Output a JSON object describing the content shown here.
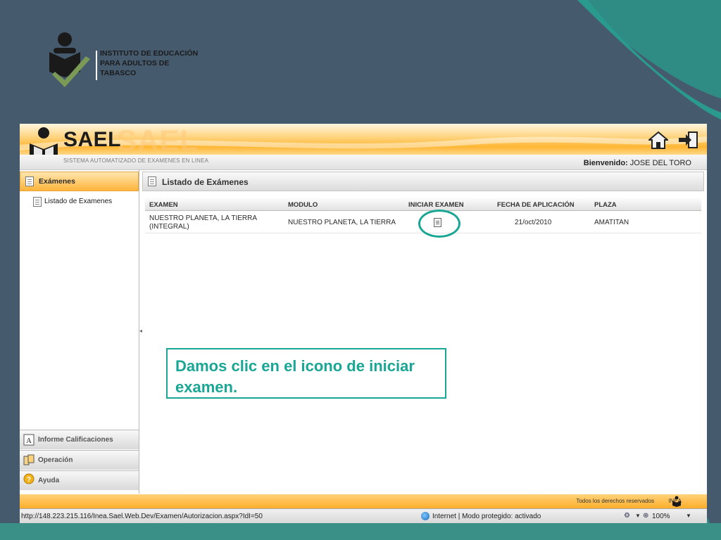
{
  "colors": {
    "slide_bg": "#465a6e",
    "teal": "#1aa695",
    "orange": "#ffb43a"
  },
  "institute": {
    "line1": "INSTITUTO DE EDUCACIÓN",
    "line2": "PARA ADULTOS DE",
    "line3": "TABASCO"
  },
  "app": {
    "title": "SAEL",
    "subtitle": "SISTEMA AUTOMATIZADO DE EXAMENES EN LINEA",
    "welcome_label": "Bienvenido:",
    "welcome_user": "JOSE DEL TORO",
    "icons": {
      "home": "home-icon",
      "logout": "logout-icon"
    }
  },
  "sidebar": {
    "active_section": "Exámenes",
    "items": [
      {
        "label": "Listado de Examenes"
      }
    ],
    "sections": [
      {
        "label": "Informe Calificaciones",
        "icon": "grade-a-icon"
      },
      {
        "label": "Operación",
        "icon": "operation-icon"
      },
      {
        "label": "Ayuda",
        "icon": "help-icon"
      }
    ]
  },
  "main": {
    "title": "Listado de Exámenes",
    "columns": [
      "EXAMEN",
      "MODULO",
      "INICIAR EXAMEN",
      "FECHA DE APLICACIÓN",
      "PLAZA"
    ],
    "rows": [
      {
        "examen_line1": "NUESTRO PLANETA, LA TIERRA",
        "examen_line2": "(INTEGRAL)",
        "modulo": "NUESTRO PLANETA, LA TIERRA",
        "fecha": "21/oct/2010",
        "plaza": "AMATITAN"
      }
    ]
  },
  "footer": {
    "rights": "Todos los derechos reservados",
    "brand": "INEA"
  },
  "statusbar": {
    "url": "http://148.223.215.116/Inea.Sael.Web.Dev/Examen/Autorizacion.aspx?IdI=50",
    "zone": "Internet | Modo protegido: activado",
    "zoom": "100%"
  },
  "callout": {
    "text": "Damos clic en el icono de iniciar examen."
  }
}
